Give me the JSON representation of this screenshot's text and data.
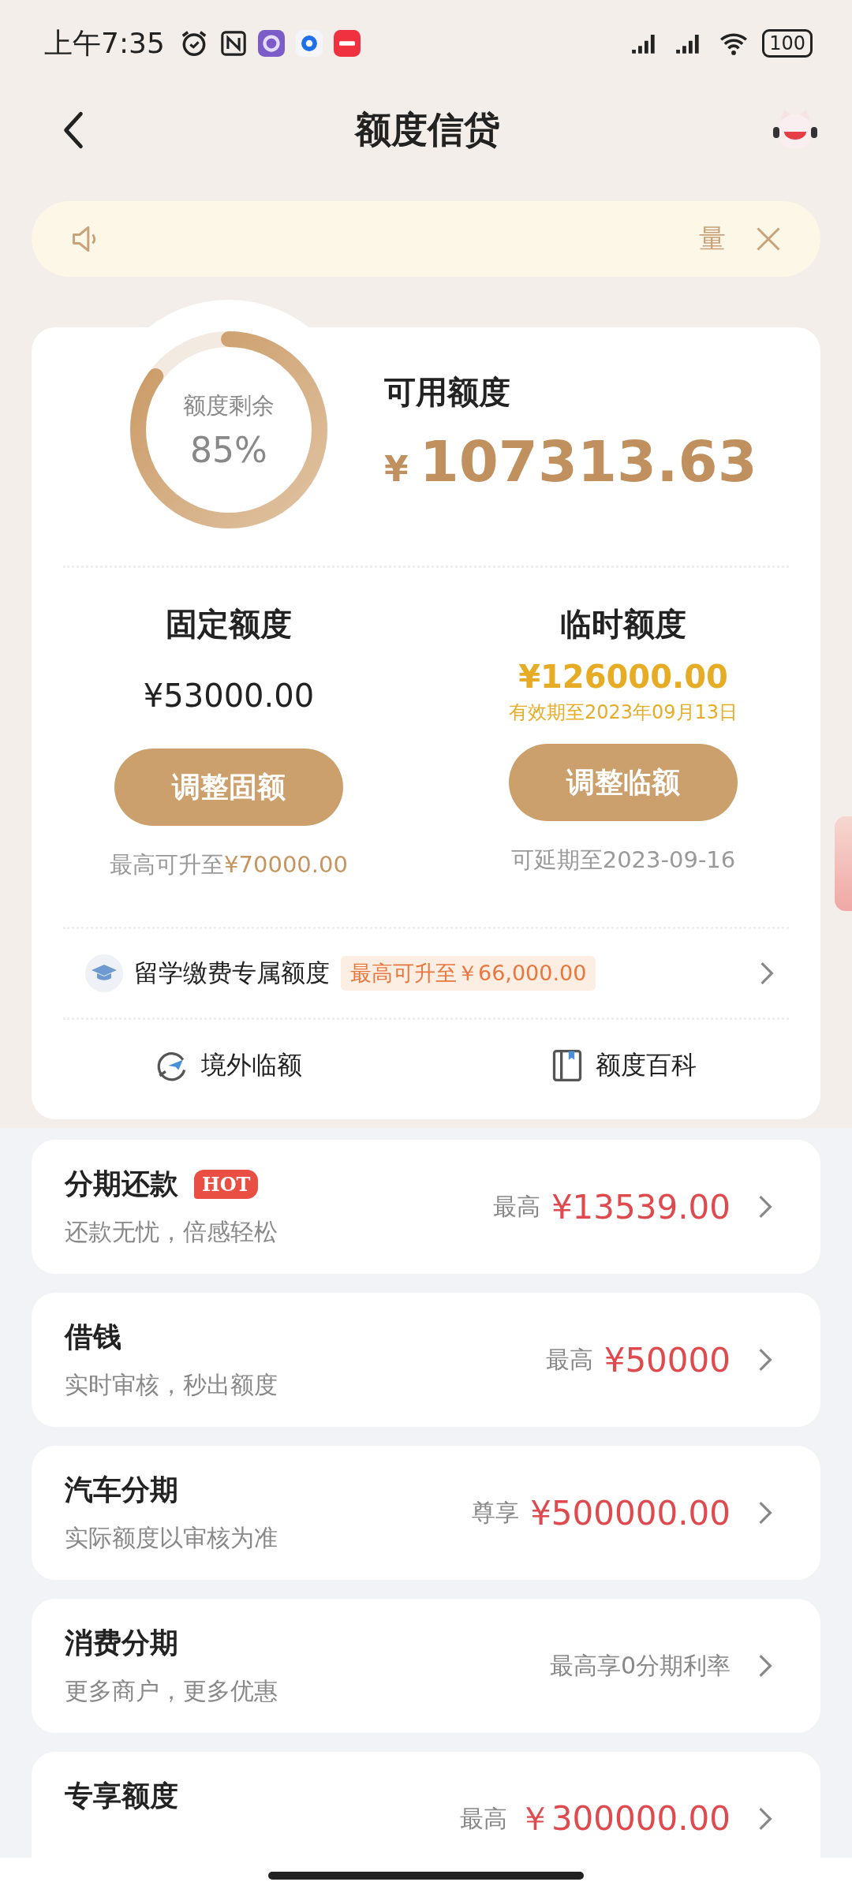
{
  "status_bar": {
    "time": "上午7:35",
    "battery": "100"
  },
  "header": {
    "title": "额度信贷"
  },
  "notice": {
    "text": "量"
  },
  "quota": {
    "ring_label": "额度剩余",
    "ring_value": "85%",
    "available_label": "可用额度",
    "currency": "¥",
    "available_amount": "107313.63"
  },
  "limits": [
    {
      "kind": "fixed",
      "label": "固定额度",
      "amount": "¥53000.00",
      "button": "调整固额",
      "note": "最高可升至",
      "note_amount": "¥70000.00"
    },
    {
      "kind": "temporary",
      "label": "临时额度",
      "amount": "¥126000.00",
      "validity": "有效期至2023年09月13日",
      "button": "调整临额",
      "note": "可延期至2023-09-16"
    }
  ],
  "study": {
    "label": "留学缴费专属额度",
    "tag": "最高可升至￥66,000.00"
  },
  "links": [
    {
      "kind": "overseas",
      "label": "境外临额"
    },
    {
      "kind": "wiki",
      "label": "额度百科"
    }
  ],
  "products": [
    {
      "title": "分期还款",
      "badge": "HOT",
      "subtitle": "还款无忧，倍感轻松",
      "prefix": "最高",
      "amount": "¥13539.00"
    },
    {
      "title": "借钱",
      "subtitle": "实时审核，秒出额度",
      "prefix": "最高",
      "amount": "¥50000"
    },
    {
      "title": "汽车分期",
      "subtitle": "实际额度以审核为准",
      "prefix": "尊享",
      "amount": "¥500000.00"
    },
    {
      "title": "消费分期",
      "subtitle": "更多商户，更多优惠",
      "prefix": "最高享0分期利率"
    },
    {
      "title": "专享额度",
      "prefix": "最高",
      "amount": "￥300000.00"
    }
  ]
}
